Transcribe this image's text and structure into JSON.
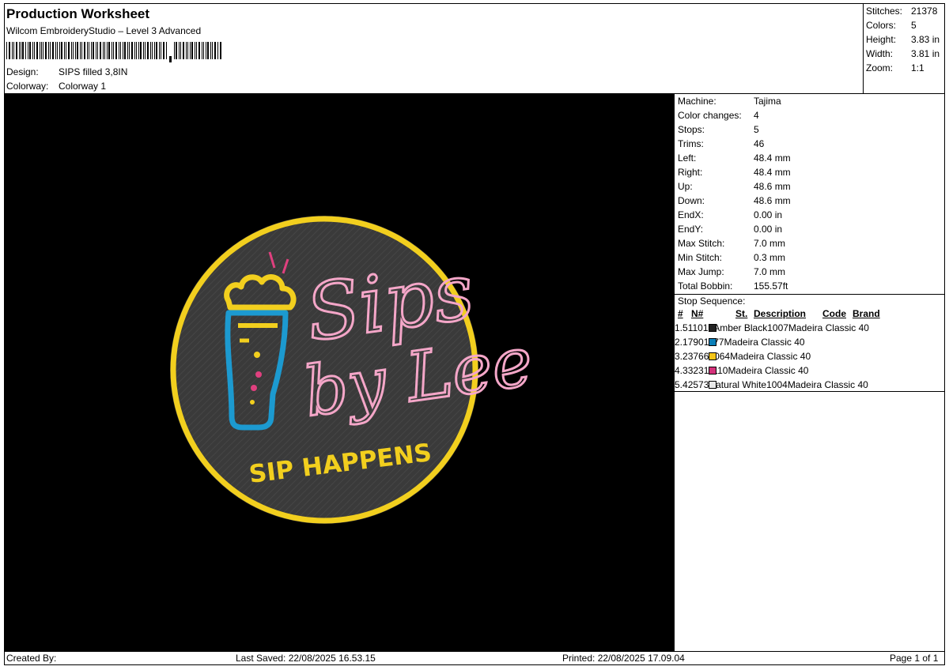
{
  "header": {
    "title": "Production Worksheet",
    "software": "Wilcom EmbroideryStudio – Level 3 Advanced",
    "design_label": "Design:",
    "design_value": "SIPS filled 3,8IN",
    "colorway_label": "Colorway:",
    "colorway_value": "Colorway 1"
  },
  "summary": [
    {
      "label": "Stitches:",
      "value": "21378"
    },
    {
      "label": "Colors:",
      "value": "5"
    },
    {
      "label": "Height:",
      "value": "3.83 in"
    },
    {
      "label": "Width:",
      "value": "3.81 in"
    },
    {
      "label": "Zoom:",
      "value": "1:1"
    }
  ],
  "details": [
    {
      "label": "Machine:",
      "value": "Tajima"
    },
    {
      "label": "Color changes:",
      "value": "4"
    },
    {
      "label": "Stops:",
      "value": "5"
    },
    {
      "label": "Trims:",
      "value": "46"
    },
    {
      "label": "Left:",
      "value": "48.4 mm"
    },
    {
      "label": "Right:",
      "value": "48.4 mm"
    },
    {
      "label": "Up:",
      "value": "48.6 mm"
    },
    {
      "label": "Down:",
      "value": "48.6 mm"
    },
    {
      "label": "EndX:",
      "value": "0.00 in"
    },
    {
      "label": "EndY:",
      "value": "0.00 in"
    },
    {
      "label": "Max Stitch:",
      "value": "7.0 mm"
    },
    {
      "label": "Min Stitch:",
      "value": "0.3 mm"
    },
    {
      "label": "Max Jump:",
      "value": "7.0 mm"
    },
    {
      "label": "Total Bobbin:",
      "value": "155.57ft"
    }
  ],
  "stop_sequence": {
    "title": "Stop Sequence:",
    "headers": {
      "num": "#",
      "n": "N#",
      "st": "St.",
      "desc": "Description",
      "code": "Code",
      "brand": "Brand"
    },
    "rows": [
      {
        "num": "1.",
        "n": "5",
        "color": "#222222",
        "st": "11016",
        "desc": "Amber Black",
        "code": "1007",
        "brand": "Madeira Classic 40"
      },
      {
        "num": "2.",
        "n": "1",
        "color": "#0b7fb8",
        "st": "790",
        "desc": "",
        "code": "1177",
        "brand": "Madeira Classic 40"
      },
      {
        "num": "3.",
        "n": "2",
        "color": "#f5c518",
        "st": "3766",
        "desc": "",
        "code": "1064",
        "brand": "Madeira Classic 40"
      },
      {
        "num": "4.",
        "n": "3",
        "color": "#d4317a",
        "st": "3231",
        "desc": "",
        "code": "1110",
        "brand": "Madeira Classic 40"
      },
      {
        "num": "5.",
        "n": "4",
        "color": "#e8e8e8",
        "st": "2573",
        "desc": "Natural White",
        "code": "1004",
        "brand": "Madeira Classic 40"
      }
    ]
  },
  "design_art": {
    "line1": "Sips",
    "line2": "by Lee",
    "line3": "SIP HAPPENS",
    "colors": {
      "background": "#000000",
      "patch": "#3a3a3a",
      "ring": "#f2cf1e",
      "glass": "#1c9ad0",
      "script": "#f4a6c8",
      "drop": "#e0407f"
    }
  },
  "footer": {
    "created": "Created By:",
    "saved": "Last Saved: 22/08/2025 16.53.15",
    "printed": "Printed: 22/08/2025 17.09.04",
    "page": "Page 1 of 1"
  }
}
